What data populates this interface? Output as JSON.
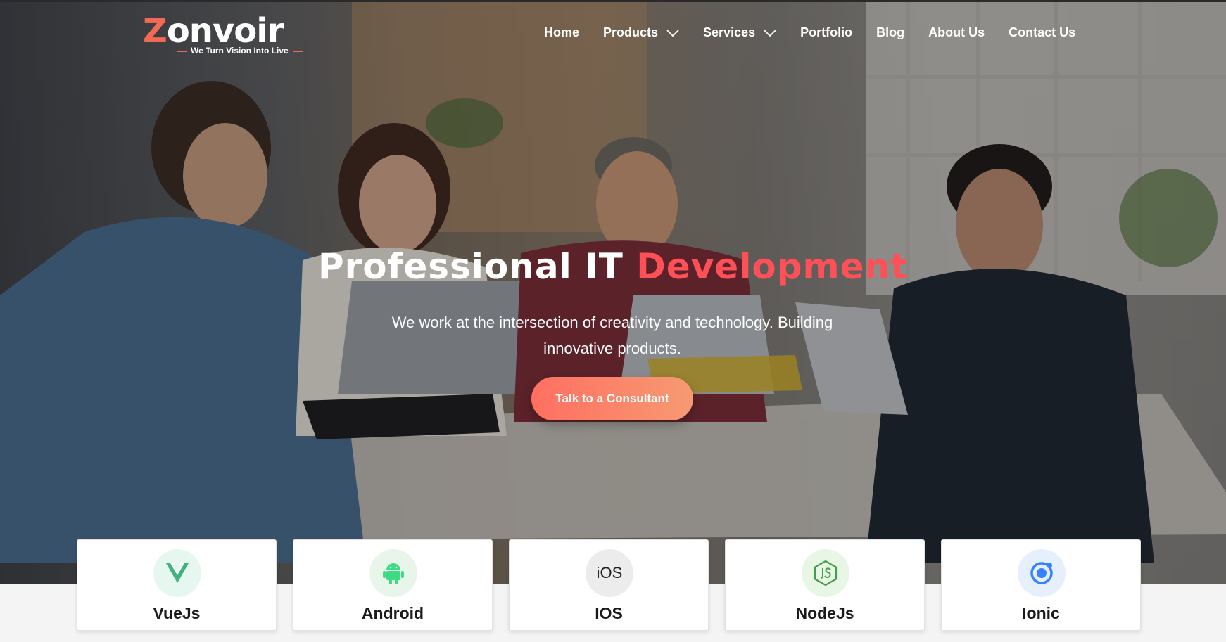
{
  "brand": {
    "logo_word": "onvoir",
    "logo_letter": "Z",
    "tagline": "We Turn Vision Into Live",
    "accent_color": "#f26a55"
  },
  "nav": {
    "items": [
      {
        "label": "Home",
        "dropdown": false
      },
      {
        "label": "Products",
        "dropdown": true
      },
      {
        "label": "Services",
        "dropdown": true
      },
      {
        "label": "Portfolio",
        "dropdown": false
      },
      {
        "label": "Blog",
        "dropdown": false
      },
      {
        "label": "About Us",
        "dropdown": false
      },
      {
        "label": "Contact Us",
        "dropdown": false
      }
    ]
  },
  "hero": {
    "headline_main": "Professional IT ",
    "headline_accent": "Development",
    "headline_accent_color": "#ff4f57",
    "subtext": "We work at the intersection of creativity and technology. Building innovative products.",
    "cta_label": "Talk to a Consultant"
  },
  "tech_cards": [
    {
      "label": "VueJs",
      "icon": "vue-icon",
      "badge_color": "#e6f7ef"
    },
    {
      "label": "Android",
      "icon": "android-icon",
      "badge_color": "#e8f5ea"
    },
    {
      "label": "IOS",
      "icon": "ios-icon",
      "icon_text": "iOS",
      "badge_color": "#ececec"
    },
    {
      "label": "NodeJs",
      "icon": "nodejs-icon",
      "badge_color": "#e8f6e6"
    },
    {
      "label": "Ionic",
      "icon": "ionic-icon",
      "badge_color": "#e6effc"
    }
  ]
}
